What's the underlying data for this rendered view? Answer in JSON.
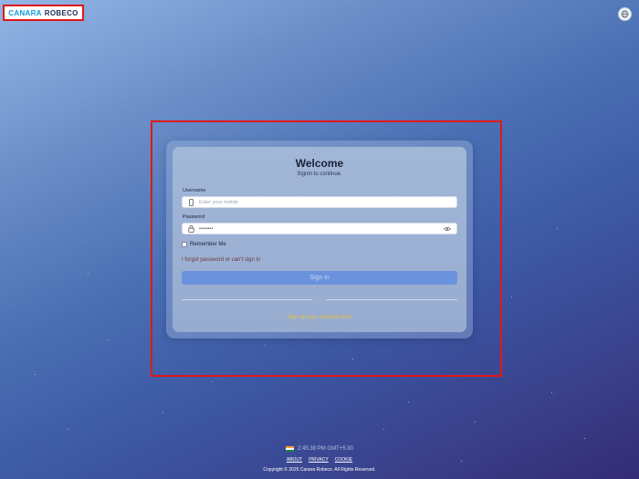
{
  "brand": {
    "part1": "CANARA",
    "part2": "ROBECO"
  },
  "login": {
    "title": "Welcome",
    "subtitle": "Signin to continue.",
    "username_label": "Username",
    "username_placeholder": "Enter your mobile",
    "password_label": "Password",
    "password_value": "••••••••",
    "remember_label": "Remember Me",
    "forgot_link": "I forgot password or can't sign in",
    "signin_button": "Sign in",
    "signup_link": "Sign up your account now!"
  },
  "footer": {
    "time": "2:45:38 PM GMT+5:30",
    "links": [
      "ABOUT",
      "PRIVACY",
      "COOKIE"
    ],
    "copyright": "Copyright © 2025 Canara Robeco. All Rights Reserved."
  },
  "icons": {
    "top_right": "globe-icon",
    "username_field": "mobile-phone-icon",
    "password_field": "lock-icon",
    "password_toggle": "eye-icon",
    "flag": "india-flag-icon"
  },
  "colors": {
    "brand_blue": "#0d9bd8",
    "brand_navy": "#1d2d5a",
    "signin_button": "#6b92dc",
    "signup_link": "#e8c23a",
    "highlight": "#e01818"
  }
}
